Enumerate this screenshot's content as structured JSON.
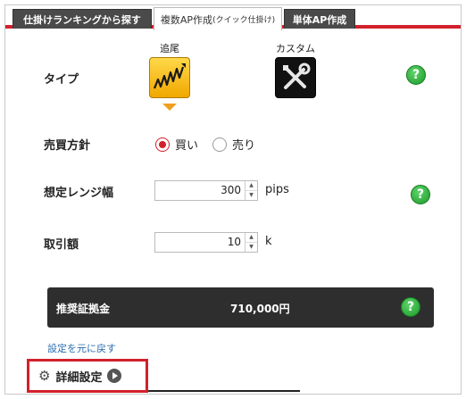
{
  "tabs": {
    "ranking": "仕掛けランキングから探す",
    "multi_main": "複数AP作成",
    "multi_sub": "(クイック仕掛け)",
    "single": "単体AP作成"
  },
  "type": {
    "label": "タイプ",
    "options": [
      {
        "caption": "追尾",
        "icon": "trend-chart-icon",
        "selected": true
      },
      {
        "caption": "カスタム",
        "icon": "wrench-screwdriver-icon",
        "selected": false
      }
    ]
  },
  "direction": {
    "label": "売買方針",
    "options": [
      {
        "label": "買い",
        "checked": true
      },
      {
        "label": "売り",
        "checked": false
      }
    ]
  },
  "range": {
    "label": "想定レンジ幅",
    "value": "300",
    "unit": "pips"
  },
  "amount": {
    "label": "取引額",
    "value": "10",
    "unit": "k"
  },
  "margin": {
    "label": "推奨証拠金",
    "value": "710,000円"
  },
  "reset_link": "設定を元に戻す",
  "detail": {
    "label": "詳細設定"
  },
  "help_symbol": "?",
  "colors": {
    "accent": "#d2202c",
    "help": "#1c9a2a",
    "link": "#2a6db0"
  }
}
